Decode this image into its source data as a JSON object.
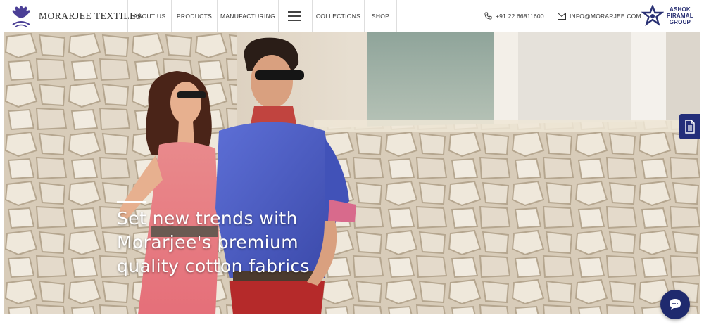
{
  "brand": {
    "name": "MORARJEE TEXTILES",
    "logo_icon": "lotus-logo-icon"
  },
  "nav": {
    "items": [
      {
        "label": "ABOUT US"
      },
      {
        "label": "PRODUCTS"
      },
      {
        "label": "MANUFACTURING"
      },
      {
        "label": "COLLECTIONS"
      },
      {
        "label": "SHOP"
      }
    ],
    "menu_icon": "hamburger-icon"
  },
  "contact": {
    "phone": "+91 22 66811600",
    "phone_icon": "phone-icon",
    "email": "INFO@MORARJEE.COM",
    "email_icon": "envelope-icon"
  },
  "group": {
    "line1": "ASHOK",
    "line2": "PIRAMAL",
    "line3": "GROUP",
    "icon": "star-logo-icon",
    "color": "#2a3174"
  },
  "hero": {
    "headline_lines": [
      "Set new trends with",
      "Morarjee's premium",
      "quality cotton fabrics"
    ]
  },
  "side_button": {
    "icon": "document-icon",
    "color": "#232e7a"
  },
  "chat_button": {
    "icon": "chat-bubble-icon",
    "color": "#1f2a6e"
  }
}
